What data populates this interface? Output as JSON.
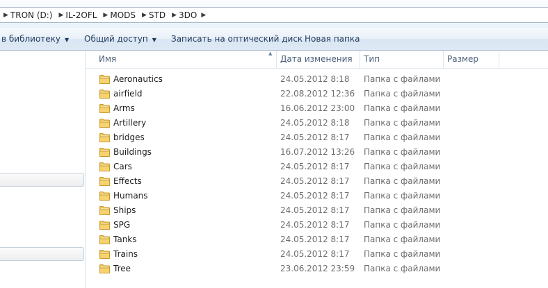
{
  "address": {
    "crumbs": [
      "TRON (D:)",
      "IL-2OFL",
      "MODS",
      "STD",
      "3DO"
    ]
  },
  "toolbar": {
    "library": "в библиотеку",
    "share": "Общий доступ",
    "burn": "Записать на оптический диск",
    "new_folder": "Новая папка"
  },
  "columns": {
    "name": "Имя",
    "date": "Дата изменения",
    "type": "Тип",
    "size": "Размер"
  },
  "files": [
    {
      "name": "Aeronautics",
      "date": "24.05.2012 8:18",
      "type": "Папка с файлами"
    },
    {
      "name": "airfield",
      "date": "22.08.2012 12:36",
      "type": "Папка с файлами"
    },
    {
      "name": "Arms",
      "date": "16.06.2012 23:00",
      "type": "Папка с файлами"
    },
    {
      "name": "Artillery",
      "date": "24.05.2012 8:18",
      "type": "Папка с файлами"
    },
    {
      "name": "bridges",
      "date": "24.05.2012 8:17",
      "type": "Папка с файлами"
    },
    {
      "name": "Buildings",
      "date": "16.07.2012 13:26",
      "type": "Папка с файлами"
    },
    {
      "name": "Cars",
      "date": "24.05.2012 8:17",
      "type": "Папка с файлами"
    },
    {
      "name": "Effects",
      "date": "24.05.2012 8:17",
      "type": "Папка с файлами"
    },
    {
      "name": "Humans",
      "date": "24.05.2012 8:17",
      "type": "Папка с файлами"
    },
    {
      "name": "Ships",
      "date": "24.05.2012 8:17",
      "type": "Папка с файлами"
    },
    {
      "name": "SPG",
      "date": "24.05.2012 8:17",
      "type": "Папка с файлами"
    },
    {
      "name": "Tanks",
      "date": "24.05.2012 8:17",
      "type": "Папка с файлами"
    },
    {
      "name": "Trains",
      "date": "24.05.2012 8:17",
      "type": "Папка с файлами"
    },
    {
      "name": "Tree",
      "date": "23.06.2012 23:59",
      "type": "Папка с файлами"
    }
  ],
  "colors": {
    "folder_fill": "#f0c659",
    "folder_edge": "#c79a2c",
    "header_text": "#4c607a",
    "meta_text": "#6d6d6d"
  },
  "icons": {
    "separator": "chevron-right-icon",
    "dropdown": "triangle-down-icon",
    "sort": "sort-up-icon",
    "folder": "folder-icon"
  }
}
